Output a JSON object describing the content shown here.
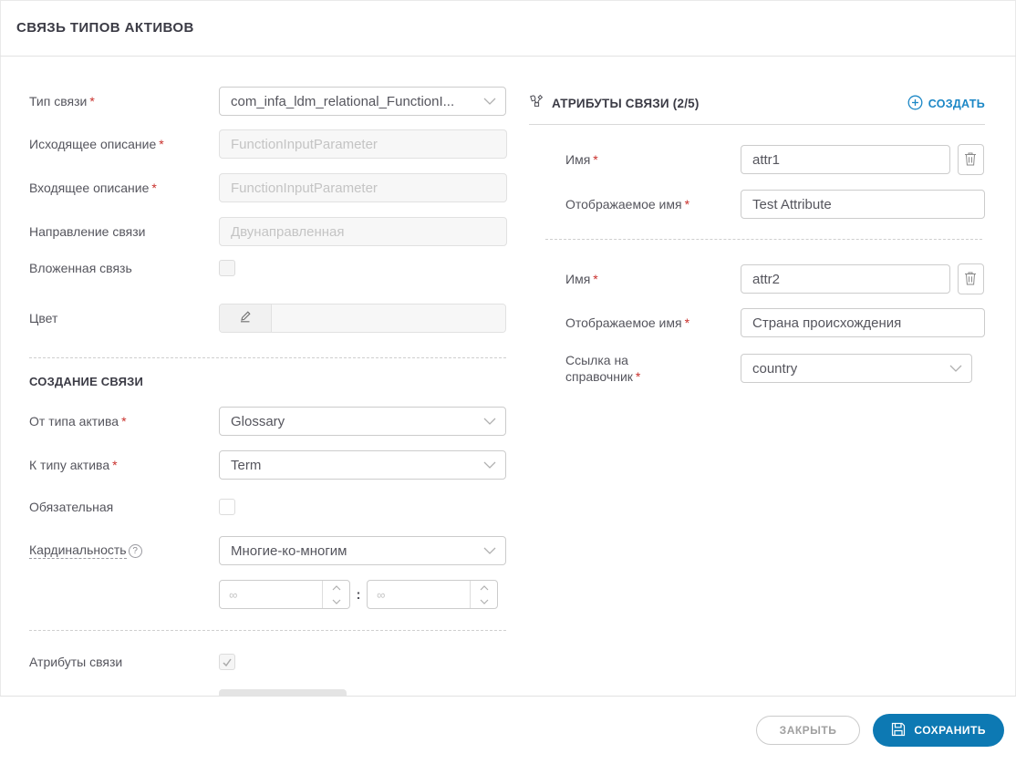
{
  "common": {
    "required_mark": "*",
    "help_glyph": "?"
  },
  "colors": {
    "accent_blue": "#1b87c6",
    "save_button_blue": "#0d79b3",
    "required_red": "#c9302c"
  },
  "icons": {
    "attributes_header": "tags-icon",
    "create": "plus-circle-icon",
    "color_edit": "pencil-icon",
    "cardinality_help": "question-circle-icon",
    "delete_attribute": "trash-icon",
    "save": "floppy-disk-icon",
    "select_arrow": "chevron-down-icon"
  },
  "header": {
    "title": "СВЯЗЬ ТИПОВ АКТИВОВ"
  },
  "form": {
    "type_label": "Тип связи",
    "type_value": "com_infa_ldm_relational_FunctionI...",
    "outgoing_label": "Исходящее описание",
    "outgoing_placeholder": "FunctionInputParameter",
    "incoming_label": "Входящее описание",
    "incoming_placeholder": "FunctionInputParameter",
    "direction_label": "Направление связи",
    "direction_placeholder": "Двунаправленная",
    "nested_label": "Вложенная связь",
    "color_label": "Цвет",
    "creation_section_title": "СОЗДАНИЕ СВЯЗИ",
    "from_label": "От типа актива",
    "from_value": "Glossary",
    "to_label": "К типу актива",
    "to_value": "Term",
    "mandatory_label": "Обязательная",
    "cardinality_label": "Кардинальность",
    "cardinality_value": "Многие-ко-многим",
    "cardinality_min_placeholder": "∞",
    "cardinality_max_placeholder": "∞",
    "cardinality_separator": ":",
    "attributes_toggle_label": "Атрибуты связи"
  },
  "attributes_panel": {
    "title": "АТРИБУТЫ СВЯЗИ (2/5)",
    "create_label": "СОЗДАТЬ",
    "name_label": "Имя",
    "display_name_label": "Отображаемое имя",
    "reference_label": "Ссылка на справочник",
    "items": [
      {
        "name": "attr1",
        "display_name": "Test Attribute"
      },
      {
        "name": "attr2",
        "display_name": "Страна происхождения",
        "reference": "country"
      }
    ]
  },
  "footer": {
    "close_label": "ЗАКРЫТЬ",
    "save_label": "СОХРАНИТЬ"
  }
}
